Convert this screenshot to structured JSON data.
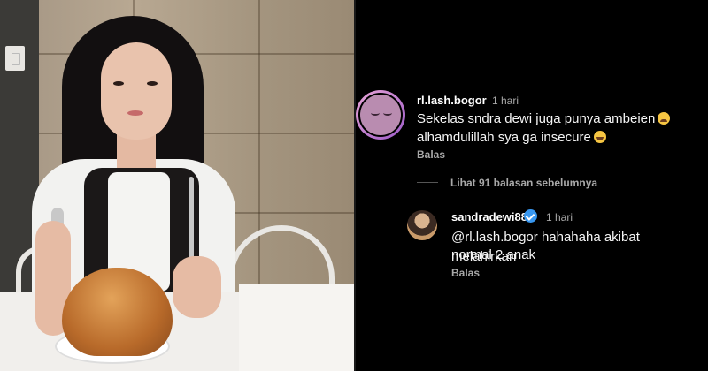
{
  "comments": [
    {
      "username": "rl.lash.bogor",
      "time": "1 hari",
      "text_line1": "Sekelas sndra dewi juga punya ambeien",
      "text_line2": "alhamdulillah sya ga insecure",
      "reply_label": "Balas"
    }
  ],
  "view_replies": "Lihat 91 balasan sebelumnya",
  "reply": {
    "username": "sandradewi88",
    "time": "1 hari",
    "text_line1": "@rl.lash.bogor hahahaha akibat melahirkan",
    "text_line2": "normal 2 anak",
    "reply_label": "Balas"
  },
  "icons": {
    "emoji_crying": "loudly-crying-face-icon",
    "emoji_laughing": "grinning-sweat-face-icon",
    "verified": "verified-badge-icon"
  },
  "colors": {
    "background": "#000000",
    "username": "#ffffff",
    "secondary_text": "#a8a8a8",
    "verified": "#3897f0"
  }
}
